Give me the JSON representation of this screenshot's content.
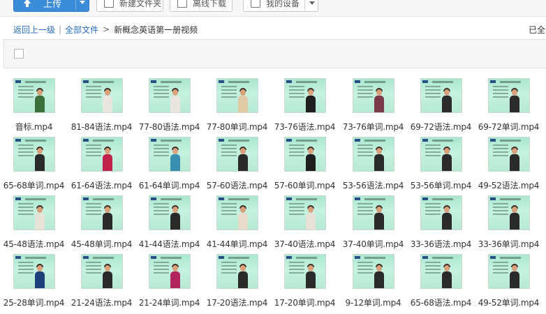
{
  "toolbar": {
    "upload_label": "上传",
    "new_folder_label": "新建文件夹",
    "offline_download_label": "离线下载",
    "my_device_label": "我的设备"
  },
  "breadcrumb": {
    "back_label": "返回上一级",
    "separator": "|",
    "all_files_label": "全部文件",
    "arrow": ">",
    "current_folder": "新概念英语第一册视频"
  },
  "status": {
    "loaded_text": "已全"
  },
  "files": [
    {
      "name": "音标.mp4",
      "shirt": "#3d6f3a"
    },
    {
      "name": "81-84语法.mp4",
      "shirt": "#e9e6df"
    },
    {
      "name": "77-80语法.mp4",
      "shirt": "#e9e6df"
    },
    {
      "name": "77-80单词.mp4",
      "shirt": "#e0c9a6"
    },
    {
      "name": "73-76语法.mp4",
      "shirt": "#1f1f1f"
    },
    {
      "name": "73-76单词.mp4",
      "shirt": "#7a3a4a"
    },
    {
      "name": "69-72语法.mp4",
      "shirt": "#2b2b2b"
    },
    {
      "name": "69-72单词.mp4",
      "shirt": "#2b2b2b"
    },
    {
      "name": "65-68单词.mp4",
      "shirt": "#2a2a2a"
    },
    {
      "name": "61-64语法.mp4",
      "shirt": "#c0234a"
    },
    {
      "name": "61-64单词.mp4",
      "shirt": "#3a8fb0"
    },
    {
      "name": "57-60语法.mp4",
      "shirt": "#2a2a2a"
    },
    {
      "name": "57-60单词.mp4",
      "shirt": "#1f1f1f"
    },
    {
      "name": "53-56语法.mp4",
      "shirt": "#2a2a2a"
    },
    {
      "name": "53-56单词.mp4",
      "shirt": "#2a2a2a"
    },
    {
      "name": "49-52语法.mp4",
      "shirt": "#2a2a2a"
    },
    {
      "name": "45-48语法.mp4",
      "shirt": "#e7e3d8"
    },
    {
      "name": "45-48单词.mp4",
      "shirt": "#2a2a2a"
    },
    {
      "name": "41-44语法.mp4",
      "shirt": "#2a2a2a"
    },
    {
      "name": "41-44单词.mp4",
      "shirt": "#e7dccc"
    },
    {
      "name": "37-40语法.mp4",
      "shirt": "#e7e3d8"
    },
    {
      "name": "37-40单词.mp4",
      "shirt": "#2a2a2a"
    },
    {
      "name": "33-36语法.mp4",
      "shirt": "#2a2a2a"
    },
    {
      "name": "33-36单词.mp4",
      "shirt": "#2a2a2a"
    },
    {
      "name": "25-28单词.mp4",
      "shirt": "#1e3f7a"
    },
    {
      "name": "21-24语法.mp4",
      "shirt": "#2a2a2a"
    },
    {
      "name": "21-24单词.mp4",
      "shirt": "#b0265c"
    },
    {
      "name": "17-20语法.mp4",
      "shirt": "#2a2a2a"
    },
    {
      "name": "17-20单词.mp4",
      "shirt": "#2a2a2a"
    },
    {
      "name": "9-12单词.mp4",
      "shirt": "#2a2a2a"
    },
    {
      "name": "65-68语法.mp4",
      "shirt": "#2a2a2a"
    },
    {
      "name": "49-52单词.mp4",
      "shirt": "#2a2a2a"
    }
  ],
  "colors": {
    "primary_button": "#3b8cd9",
    "link": "#2a6dbd",
    "thumbnail_background": "#b6e9d4"
  }
}
